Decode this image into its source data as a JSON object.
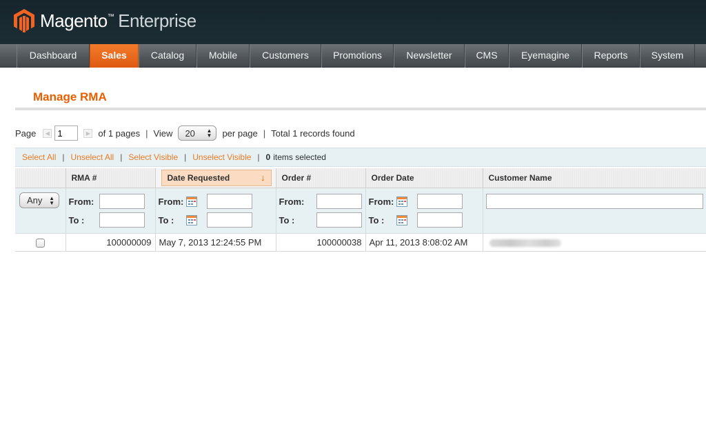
{
  "header": {
    "brand": "Magento",
    "trademark": "™",
    "edition": "Enterprise",
    "colors": {
      "logo_orange": "#f26322",
      "header_bg": "#1a2a31",
      "accent": "#eb5e00"
    }
  },
  "nav": {
    "items": [
      {
        "label": "Dashboard",
        "active": false
      },
      {
        "label": "Sales",
        "active": true
      },
      {
        "label": "Catalog",
        "active": false
      },
      {
        "label": "Mobile",
        "active": false
      },
      {
        "label": "Customers",
        "active": false
      },
      {
        "label": "Promotions",
        "active": false
      },
      {
        "label": "Newsletter",
        "active": false
      },
      {
        "label": "CMS",
        "active": false
      },
      {
        "label": "Eyemagine",
        "active": false
      },
      {
        "label": "Reports",
        "active": false
      },
      {
        "label": "System",
        "active": false
      }
    ]
  },
  "page": {
    "title": "Manage RMA"
  },
  "pager": {
    "page_label": "Page",
    "page_value": "1",
    "of_pages": "of 1 pages",
    "sep": "|",
    "view_label": "View",
    "view_value": "20",
    "per_page": "per page",
    "total": "Total 1 records found"
  },
  "massaction": {
    "select_all": "Select All",
    "unselect_all": "Unselect All",
    "select_visible": "Select Visible",
    "unselect_visible": "Unselect Visible",
    "sep": "|",
    "count": "0",
    "items_selected": "items selected"
  },
  "grid": {
    "columns": {
      "rma": "RMA #",
      "date_requested": "Date Requested",
      "order": "Order #",
      "order_date": "Order Date",
      "customer_name": "Customer Name"
    },
    "sort_indicator": "↓",
    "filters": {
      "any": "Any",
      "from": "From:",
      "to": "To :"
    },
    "rows": [
      {
        "rma": "100000009",
        "date_requested": "May 7, 2013 12:24:55 PM",
        "order": "100000038",
        "order_date": "Apr 11, 2013 8:08:02 AM",
        "customer_name": "Redacted name"
      }
    ]
  }
}
